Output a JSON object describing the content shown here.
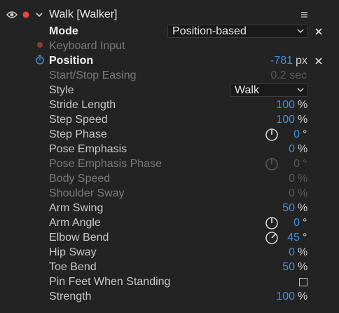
{
  "effect": {
    "name": "Walk [Walker]",
    "visible": true,
    "label_color": "#e8483f"
  },
  "mode": {
    "label": "Mode",
    "value": "Position-based"
  },
  "keyboard_input": {
    "label": "Keyboard Input"
  },
  "position": {
    "label": "Position",
    "value": "-781",
    "unit": "px"
  },
  "easing": {
    "label": "Start/Stop Easing",
    "value": "0.2 sec"
  },
  "style": {
    "label": "Style",
    "value": "Walk"
  },
  "properties": [
    {
      "label": "Stride Length",
      "value": "100",
      "unit": "%",
      "dim": false,
      "dial": "none"
    },
    {
      "label": "Step Speed",
      "value": "100",
      "unit": "%",
      "dim": false,
      "dial": "none"
    },
    {
      "label": "Step Phase",
      "value": "0",
      "unit": "°",
      "dim": false,
      "dial": "normal"
    },
    {
      "label": "Pose Emphasis",
      "value": "0",
      "unit": "%",
      "dim": false,
      "dial": "none"
    },
    {
      "label": "Pose Emphasis Phase",
      "value": "0",
      "unit": "°",
      "dim": true,
      "dial": "dim"
    },
    {
      "label": "Body Speed",
      "value": "0",
      "unit": "%",
      "dim": true,
      "dial": "none"
    },
    {
      "label": "Shoulder Sway",
      "value": "0",
      "unit": "%",
      "dim": true,
      "dial": "none"
    },
    {
      "label": "Arm Swing",
      "value": "50",
      "unit": "%",
      "dim": false,
      "dial": "none"
    },
    {
      "label": "Arm Angle",
      "value": "0",
      "unit": "°",
      "dim": false,
      "dial": "normal"
    },
    {
      "label": "Elbow Bend",
      "value": "45",
      "unit": "°",
      "dim": false,
      "dial": "rotated"
    },
    {
      "label": "Hip Sway",
      "value": "0",
      "unit": "%",
      "dim": false,
      "dial": "none"
    },
    {
      "label": "Toe Bend",
      "value": "50",
      "unit": "%",
      "dim": false,
      "dial": "none"
    }
  ],
  "pin_feet": {
    "label": "Pin Feet When Standing",
    "checked": false
  },
  "strength": {
    "label": "Strength",
    "value": "100",
    "unit": "%"
  },
  "colors": {
    "background": "#232323",
    "value_blue": "#3f8fde",
    "label": "#c7c7c7",
    "dim": "#5a5a5a"
  },
  "icons": {
    "visibility": "eye-icon",
    "record": "record-dot-icon",
    "expand": "chevron-down-icon",
    "menu": "hamburger-menu-icon",
    "reset": "close-icon",
    "stopwatch": "stopwatch-icon",
    "angle": "angle-dial-icon"
  }
}
